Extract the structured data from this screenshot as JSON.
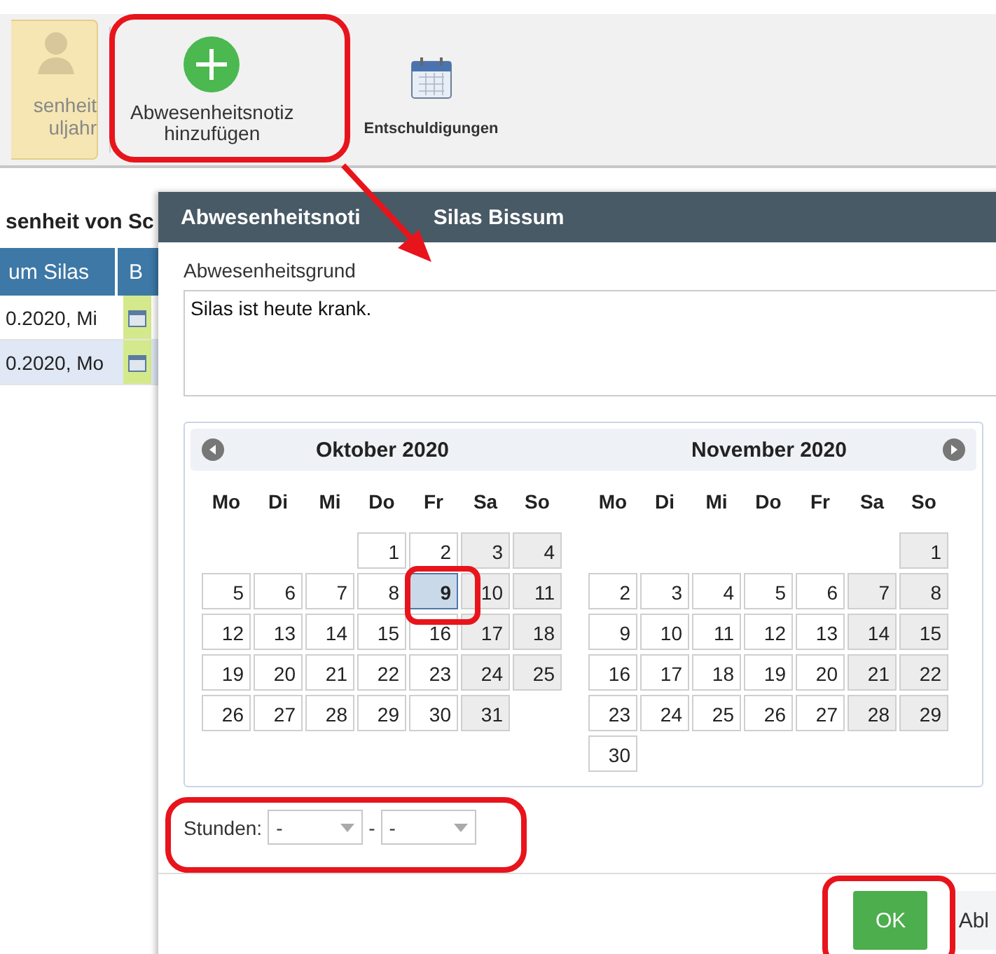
{
  "toolbar": {
    "items": [
      {
        "kind": "profile",
        "lines": [
          "senheit",
          "uljahr"
        ]
      },
      {
        "kind": "add",
        "lines": [
          "Abwesenheitsnotiz",
          "hinzufügen"
        ]
      },
      {
        "kind": "calendar",
        "lines": [
          "Entschuldigungen"
        ]
      }
    ]
  },
  "section_heading": "senheit von Sc",
  "table": {
    "columns": [
      "um Silas",
      "B"
    ],
    "rows": [
      {
        "cells": [
          "0.2020, Mi"
        ]
      },
      {
        "cells": [
          "0.2020, Mo"
        ]
      }
    ]
  },
  "dialog": {
    "title_parts": [
      "Abwesenheitsnoti",
      "Silas Bissum"
    ],
    "reason_label": "Abwesenheitsgrund",
    "reason_value": "Silas ist heute krank.",
    "calendar": {
      "months": [
        {
          "title": "Oktober 2020",
          "weekdays": [
            "Mo",
            "Di",
            "Mi",
            "Do",
            "Fr",
            "Sa",
            "So"
          ],
          "weeks": [
            [
              {
                "kind": "empty"
              },
              {
                "kind": "empty"
              },
              {
                "kind": "empty"
              },
              {
                "day": "1",
                "selected": false
              },
              {
                "day": "2",
                "selected": false
              },
              {
                "day": "3",
                "selected": false
              },
              {
                "day": "4",
                "selected": false
              }
            ],
            [
              {
                "day": "5",
                "selected": false
              },
              {
                "day": "6",
                "selected": false
              },
              {
                "day": "7",
                "selected": false
              },
              {
                "day": "8",
                "selected": false
              },
              {
                "day": "9",
                "selected": true
              },
              {
                "day": "10",
                "selected": false
              },
              {
                "day": "11",
                "selected": false
              }
            ],
            [
              {
                "day": "12",
                "selected": false
              },
              {
                "day": "13",
                "selected": false
              },
              {
                "day": "14",
                "selected": false
              },
              {
                "day": "15",
                "selected": false
              },
              {
                "day": "16",
                "selected": false
              },
              {
                "day": "17",
                "selected": false
              },
              {
                "day": "18",
                "selected": false
              }
            ],
            [
              {
                "day": "19",
                "selected": false
              },
              {
                "day": "20",
                "selected": false
              },
              {
                "day": "21",
                "selected": false
              },
              {
                "day": "22",
                "selected": false
              },
              {
                "day": "23",
                "selected": false
              },
              {
                "day": "24",
                "selected": false
              },
              {
                "day": "25",
                "selected": false
              }
            ],
            [
              {
                "day": "26",
                "selected": false
              },
              {
                "day": "27",
                "selected": false
              },
              {
                "day": "28",
                "selected": false
              },
              {
                "day": "29",
                "selected": false
              },
              {
                "day": "30",
                "selected": false
              },
              {
                "day": "31",
                "selected": false
              },
              {
                "kind": "empty"
              }
            ]
          ]
        },
        {
          "title": "November 2020",
          "weekdays": [
            "Mo",
            "Di",
            "Mi",
            "Do",
            "Fr",
            "Sa",
            "So"
          ],
          "weeks": [
            [
              {
                "kind": "empty"
              },
              {
                "kind": "empty"
              },
              {
                "kind": "empty"
              },
              {
                "kind": "empty"
              },
              {
                "kind": "empty"
              },
              {
                "kind": "empty"
              },
              {
                "day": "1",
                "selected": false
              }
            ],
            [
              {
                "day": "2",
                "selected": false
              },
              {
                "day": "3",
                "selected": false
              },
              {
                "day": "4",
                "selected": false
              },
              {
                "day": "5",
                "selected": false
              },
              {
                "day": "6",
                "selected": false
              },
              {
                "day": "7",
                "selected": false
              },
              {
                "day": "8",
                "selected": false
              }
            ],
            [
              {
                "day": "9",
                "selected": false
              },
              {
                "day": "10",
                "selected": false
              },
              {
                "day": "11",
                "selected": false
              },
              {
                "day": "12",
                "selected": false
              },
              {
                "day": "13",
                "selected": false
              },
              {
                "day": "14",
                "selected": false
              },
              {
                "day": "15",
                "selected": false
              }
            ],
            [
              {
                "day": "16",
                "selected": false
              },
              {
                "day": "17",
                "selected": false
              },
              {
                "day": "18",
                "selected": false
              },
              {
                "day": "19",
                "selected": false
              },
              {
                "day": "20",
                "selected": false
              },
              {
                "day": "21",
                "selected": false
              },
              {
                "day": "22",
                "selected": false
              }
            ],
            [
              {
                "day": "23",
                "selected": false
              },
              {
                "day": "24",
                "selected": false
              },
              {
                "day": "25",
                "selected": false
              },
              {
                "day": "26",
                "selected": false
              },
              {
                "day": "27",
                "selected": false
              },
              {
                "day": "28",
                "selected": false
              },
              {
                "day": "29",
                "selected": false
              }
            ],
            [
              {
                "day": "30",
                "selected": false
              },
              {
                "kind": "empty"
              },
              {
                "kind": "empty"
              },
              {
                "kind": "empty"
              },
              {
                "kind": "empty"
              },
              {
                "kind": "empty"
              },
              {
                "kind": "empty"
              }
            ]
          ]
        }
      ]
    },
    "hours": {
      "label": "Stunden:",
      "from": "-",
      "separator": "-",
      "to": "-"
    },
    "buttons": [
      {
        "kind": "primary",
        "label": "OK"
      },
      {
        "kind": "secondary",
        "label": "Abl"
      }
    ]
  }
}
